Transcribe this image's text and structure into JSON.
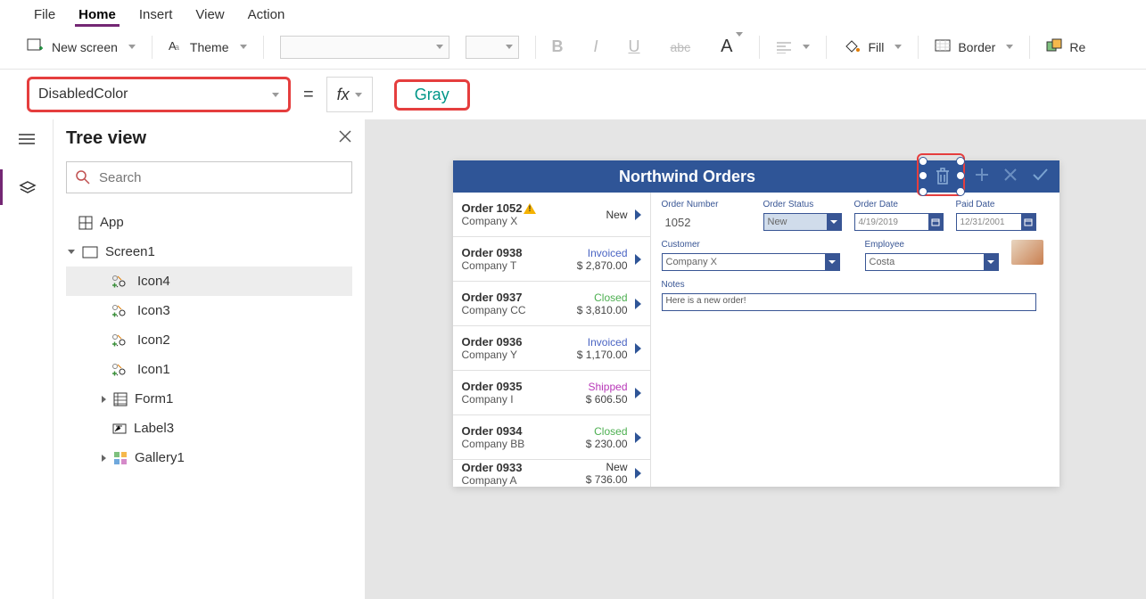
{
  "menu": {
    "file": "File",
    "home": "Home",
    "insert": "Insert",
    "view": "View",
    "action": "Action"
  },
  "ribbon": {
    "new_screen": "New screen",
    "theme": "Theme",
    "fill": "Fill",
    "border": "Border",
    "reorder": "Re"
  },
  "formula": {
    "property": "DisabledColor",
    "value": "Gray"
  },
  "tree": {
    "title": "Tree view",
    "search_placeholder": "Search",
    "app": "App",
    "screen1": "Screen1",
    "icon4": "Icon4",
    "icon3": "Icon3",
    "icon2": "Icon2",
    "icon1": "Icon1",
    "form1": "Form1",
    "label3": "Label3",
    "gallery1": "Gallery1"
  },
  "canvas": {
    "title": "Northwind Orders",
    "gallery": [
      {
        "title": "Order 1052",
        "company": "Company X",
        "status": "New",
        "status_class": "new",
        "price": "",
        "warn": true
      },
      {
        "title": "Order 0938",
        "company": "Company T",
        "status": "Invoiced",
        "status_class": "invoiced",
        "price": "$ 2,870.00"
      },
      {
        "title": "Order 0937",
        "company": "Company CC",
        "status": "Closed",
        "status_class": "closed",
        "price": "$ 3,810.00"
      },
      {
        "title": "Order 0936",
        "company": "Company Y",
        "status": "Invoiced",
        "status_class": "invoiced",
        "price": "$ 1,170.00"
      },
      {
        "title": "Order 0935",
        "company": "Company I",
        "status": "Shipped",
        "status_class": "shipped",
        "price": "$ 606.50"
      },
      {
        "title": "Order 0934",
        "company": "Company BB",
        "status": "Closed",
        "status_class": "closed",
        "price": "$ 230.00"
      },
      {
        "title": "Order 0933",
        "company": "Company A",
        "status": "New",
        "status_class": "new",
        "price": "$ 736.00"
      }
    ],
    "form": {
      "order_number_label": "Order Number",
      "order_number": "1052",
      "order_status_label": "Order Status",
      "order_status": "New",
      "order_date_label": "Order Date",
      "order_date": "4/19/2019",
      "paid_date_label": "Paid Date",
      "paid_date": "12/31/2001",
      "customer_label": "Customer",
      "customer": "Company X",
      "employee_label": "Employee",
      "employee": "Costa",
      "notes_label": "Notes",
      "notes": "Here is a new order!"
    }
  }
}
